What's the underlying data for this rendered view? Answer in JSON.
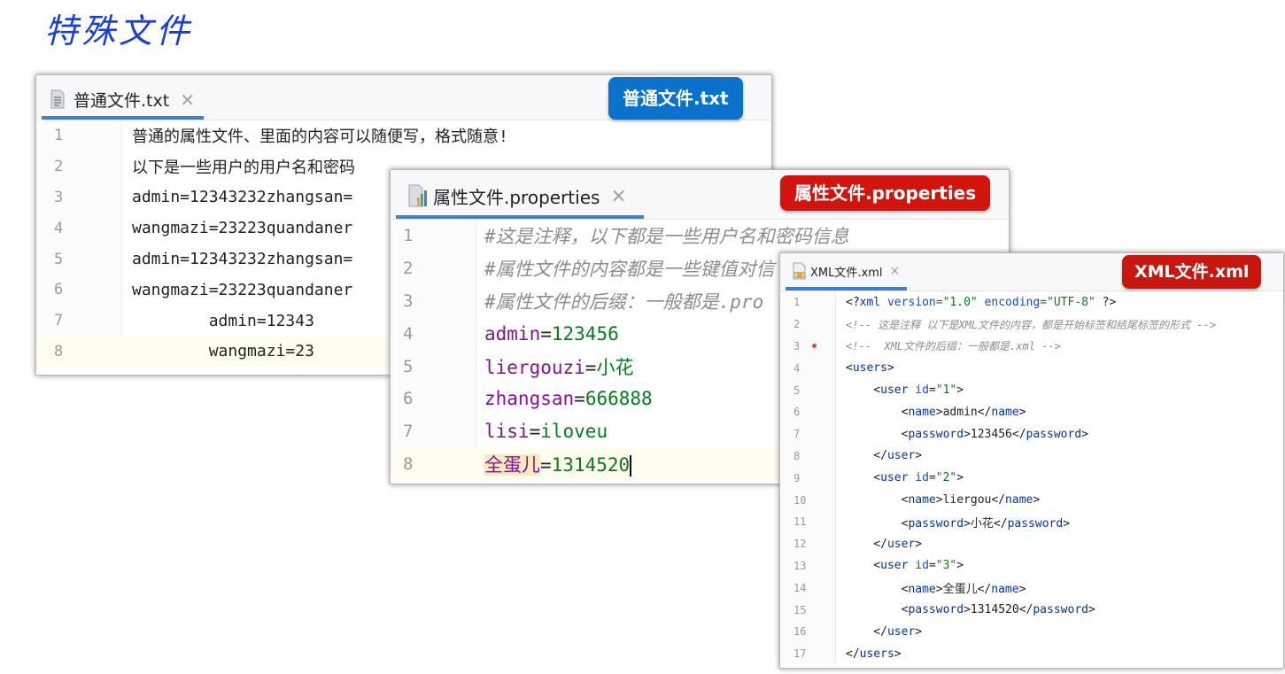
{
  "page_title": "特殊文件",
  "colors": {
    "badge_txt": "#0a72cc",
    "badge_props": "#d2140c",
    "badge_xml": "#c8170f",
    "tab_underline": "#3e7fd8"
  },
  "txt_window": {
    "tab_label": "普通文件.txt",
    "close_icon": "×",
    "badge": "普通文件.txt",
    "lines": [
      {
        "n": "1",
        "text": "普通的属性文件、里面的内容可以随便写，格式随意!"
      },
      {
        "n": "2",
        "text": "以下是一些用户的用户名和密码"
      },
      {
        "n": "3",
        "text": "admin=12343232zhangsan="
      },
      {
        "n": "4",
        "text": "wangmazi=23223quandaner"
      },
      {
        "n": "5",
        "text": "admin=12343232zhangsan="
      },
      {
        "n": "6",
        "text": "wangmazi=23223quandaner"
      },
      {
        "n": "7",
        "text": "        admin=12343"
      },
      {
        "n": "8",
        "text": "        wangmazi=23"
      }
    ]
  },
  "props_window": {
    "tab_label": "属性文件.properties",
    "close_icon": "×",
    "badge": "属性文件.properties",
    "comments": [
      "#这是注释，以下都是一些用户名和密码信息",
      "#属性文件的内容都是一些键值对信",
      "#属性文件的后缀：一般都是.pro"
    ],
    "entries": [
      {
        "key": "admin",
        "eq": "=",
        "value": "123456"
      },
      {
        "key": "liergouzi",
        "eq": "=",
        "value": "小花"
      },
      {
        "key": "zhangsan",
        "eq": "=",
        "value": "666888"
      },
      {
        "key": "lisi",
        "eq": "=",
        "value": "iloveu"
      },
      {
        "key": "全蛋儿",
        "eq": "=",
        "value": "1314520"
      }
    ],
    "line_numbers": [
      "1",
      "2",
      "3",
      "4",
      "5",
      "6",
      "7",
      "8"
    ]
  },
  "xml_window": {
    "tab_label": "XML文件.xml",
    "close_icon": "×",
    "badge": "XML文件.xml",
    "line_numbers": [
      "1",
      "2",
      "3",
      "4",
      "5",
      "6",
      "7",
      "8",
      "9",
      "10",
      "11",
      "12",
      "13",
      "14",
      "15",
      "16",
      "17"
    ],
    "decl": {
      "open": "<?",
      "name": "xml",
      "a1": " version",
      "v1": "=\"1.0\"",
      "a2": " encoding",
      "v2": "=\"UTF-8\"",
      "close": " ?>"
    },
    "comment1": "<!-- 这是注释 以下是XML文件的内容，都是开始标签和结尾标签的形式 -->",
    "comment2": "<!--  XML文件的后缀：一般都是.xml -->",
    "users_open": "users",
    "users_close": "users",
    "users": [
      {
        "id": "\"1\"",
        "name": "admin",
        "password": "123456"
      },
      {
        "id": "\"2\"",
        "name": "liergou",
        "password": "小花"
      },
      {
        "id": "\"3\"",
        "name": "全蛋儿",
        "password": "1314520"
      }
    ],
    "tags": {
      "user": "user",
      "id_attr": "id",
      "name": "name",
      "password": "password"
    }
  }
}
